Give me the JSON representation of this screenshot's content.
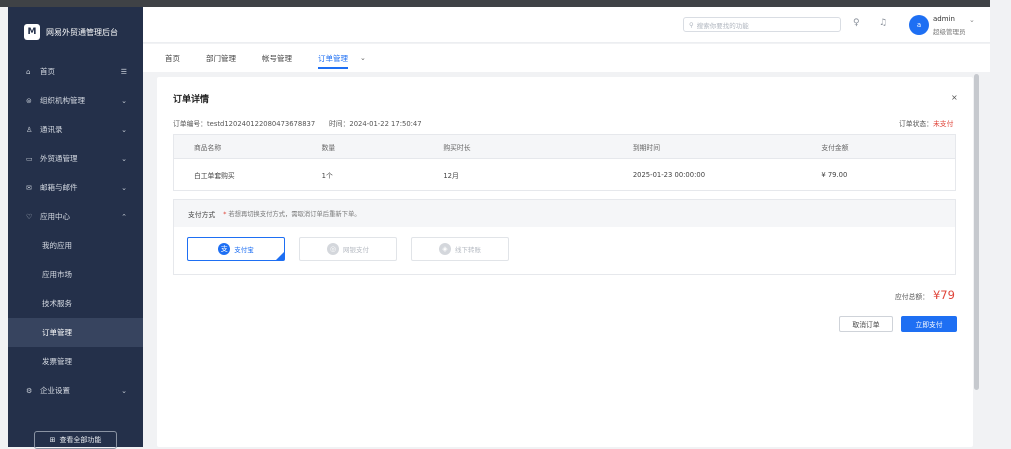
{
  "brand": {
    "logo_text": "M",
    "name": "网易外贸通管理后台"
  },
  "sidebar": {
    "items": [
      {
        "icon": "⌂",
        "label": "首页",
        "chevron": "☰"
      },
      {
        "icon": "⊜",
        "label": "组织机构管理",
        "chevron": "⌄"
      },
      {
        "icon": "♙",
        "label": "通讯录",
        "chevron": "⌄"
      },
      {
        "icon": "▭",
        "label": "外贸通管理",
        "chevron": "⌄"
      },
      {
        "icon": "✉",
        "label": "邮箱与邮件",
        "chevron": "⌄"
      },
      {
        "icon": "♡",
        "label": "应用中心",
        "chevron": "⌃"
      }
    ],
    "subitems": [
      {
        "label": "我的应用"
      },
      {
        "label": "应用市场"
      },
      {
        "label": "技术服务"
      },
      {
        "label": "订单管理"
      },
      {
        "label": "发票管理"
      }
    ],
    "enterprise": {
      "icon": "⚙",
      "label": "企业设置",
      "chevron": "⌄"
    },
    "all_functions": "查看全部功能"
  },
  "header": {
    "search_placeholder": "搜索你要找的功能",
    "user_name": "admin",
    "user_role": "超级管理员",
    "avatar_letter": "a"
  },
  "tabs": [
    {
      "label": "首页"
    },
    {
      "label": "部门管理"
    },
    {
      "label": "帐号管理"
    },
    {
      "label": "订单管理"
    }
  ],
  "order": {
    "title": "订单详情",
    "close": "×",
    "order_no": "订单编号：testd12024012208047367883​7",
    "order_time": "时间：2024-01-22 17:50:47",
    "status_label": "订单状态：",
    "status_value": "未支付",
    "columns": [
      "商品名称",
      "数量",
      "购买时长",
      "到期时间",
      "支付金额"
    ],
    "rows": [
      {
        "name": "白工单套购买",
        "qty": "1个",
        "duration": "12月",
        "expiry": "2025-01-23 00:00:00",
        "amount": "¥ 79.00"
      }
    ],
    "pay_method_label": "支付方式",
    "pay_tip": "若想再切换支付方式，需取消订单后重新下单。",
    "pay_options": [
      {
        "icon": "支",
        "label": "支付宝"
      },
      {
        "icon": "◎",
        "label": "网银支付"
      },
      {
        "icon": "◈",
        "label": "线下转账"
      }
    ],
    "payable_label": "应付总额：",
    "payable_amount": "¥79",
    "cancel_button": "取消订单",
    "pay_button": "立即支付"
  }
}
